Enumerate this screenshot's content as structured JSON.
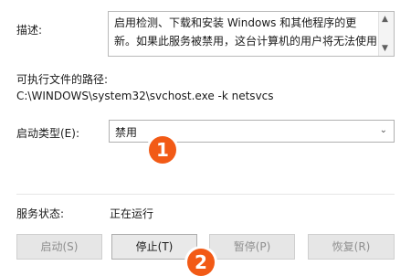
{
  "description": {
    "label": "描述:",
    "text": "启用检测、下载和安装 Windows 和其他程序的更新。如果此服务被禁用，这台计算机的用户将无法使用"
  },
  "executable": {
    "label": "可执行文件的路径:",
    "path": "C:\\WINDOWS\\system32\\svchost.exe -k netsvcs"
  },
  "startup_type": {
    "label": "启动类型(E):",
    "value": "禁用"
  },
  "service_status": {
    "label": "服务状态:",
    "value": "正在运行"
  },
  "buttons": {
    "start": "启动(S)",
    "stop": "停止(T)",
    "pause": "暂停(P)",
    "resume": "恢复(R)"
  },
  "badges": {
    "one": "1",
    "two": "2"
  },
  "colors": {
    "badge": "#f25a16"
  }
}
